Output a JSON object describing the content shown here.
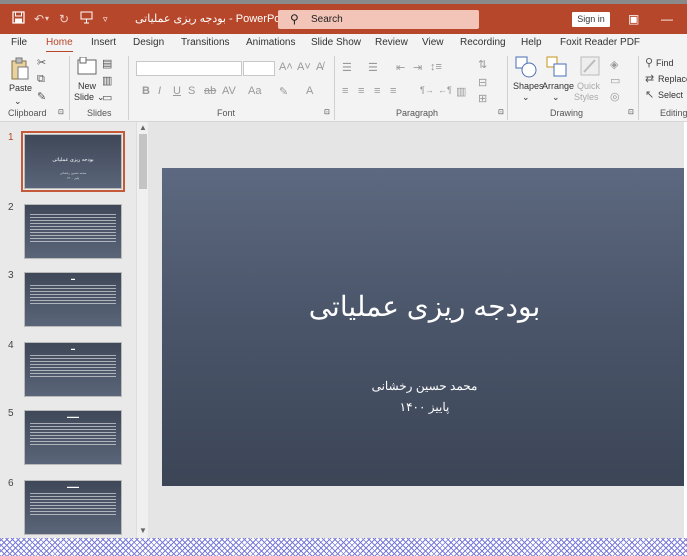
{
  "window": {
    "title": "بودجه ریزی عملیاتی  -  PowerPoint",
    "search_placeholder": "Search",
    "signin_label": "Sign in",
    "minimize_glyph": "—",
    "restore_glyph": "▣"
  },
  "tabs": [
    {
      "label": "File"
    },
    {
      "label": "Home"
    },
    {
      "label": "Insert"
    },
    {
      "label": "Design"
    },
    {
      "label": "Transitions"
    },
    {
      "label": "Animations"
    },
    {
      "label": "Slide Show"
    },
    {
      "label": "Review"
    },
    {
      "label": "View"
    },
    {
      "label": "Recording"
    },
    {
      "label": "Help"
    },
    {
      "label": "Foxit Reader PDF"
    }
  ],
  "active_tab": "Home",
  "ribbon": {
    "groups": {
      "clipboard": "Clipboard",
      "slides": "Slides",
      "font": "Font",
      "paragraph": "Paragraph",
      "drawing": "Drawing",
      "editing": "Editing"
    },
    "paste_label": "Paste",
    "new_label": "New",
    "slide_label": "Slide",
    "shapes_label": "Shapes",
    "arrange_label": "Arrange",
    "quick_label": "Quick",
    "styles_label": "Styles",
    "find_label": "Find",
    "replace_label": "Replace",
    "select_label": "Select"
  },
  "thumbnails": [
    {
      "number": "1",
      "selected": true,
      "title": "بودجه ریزی عملیاتی",
      "subtitle1": "محمد حسین رخشانی",
      "subtitle2": "پاییز ۱۴۰۰"
    },
    {
      "number": "2",
      "selected": false
    },
    {
      "number": "3",
      "selected": false
    },
    {
      "number": "4",
      "selected": false
    },
    {
      "number": "5",
      "selected": false
    },
    {
      "number": "6",
      "selected": false
    }
  ],
  "slide": {
    "title": "بودجه ریزی عملیاتی",
    "subtitle_line1": "محمد حسین رخشانی",
    "subtitle_line2": "پاییز ۱۴۰۰"
  },
  "colors": {
    "accent": "#b7472a",
    "slide_top": "#5d6980",
    "slide_bottom": "#3b4556"
  }
}
